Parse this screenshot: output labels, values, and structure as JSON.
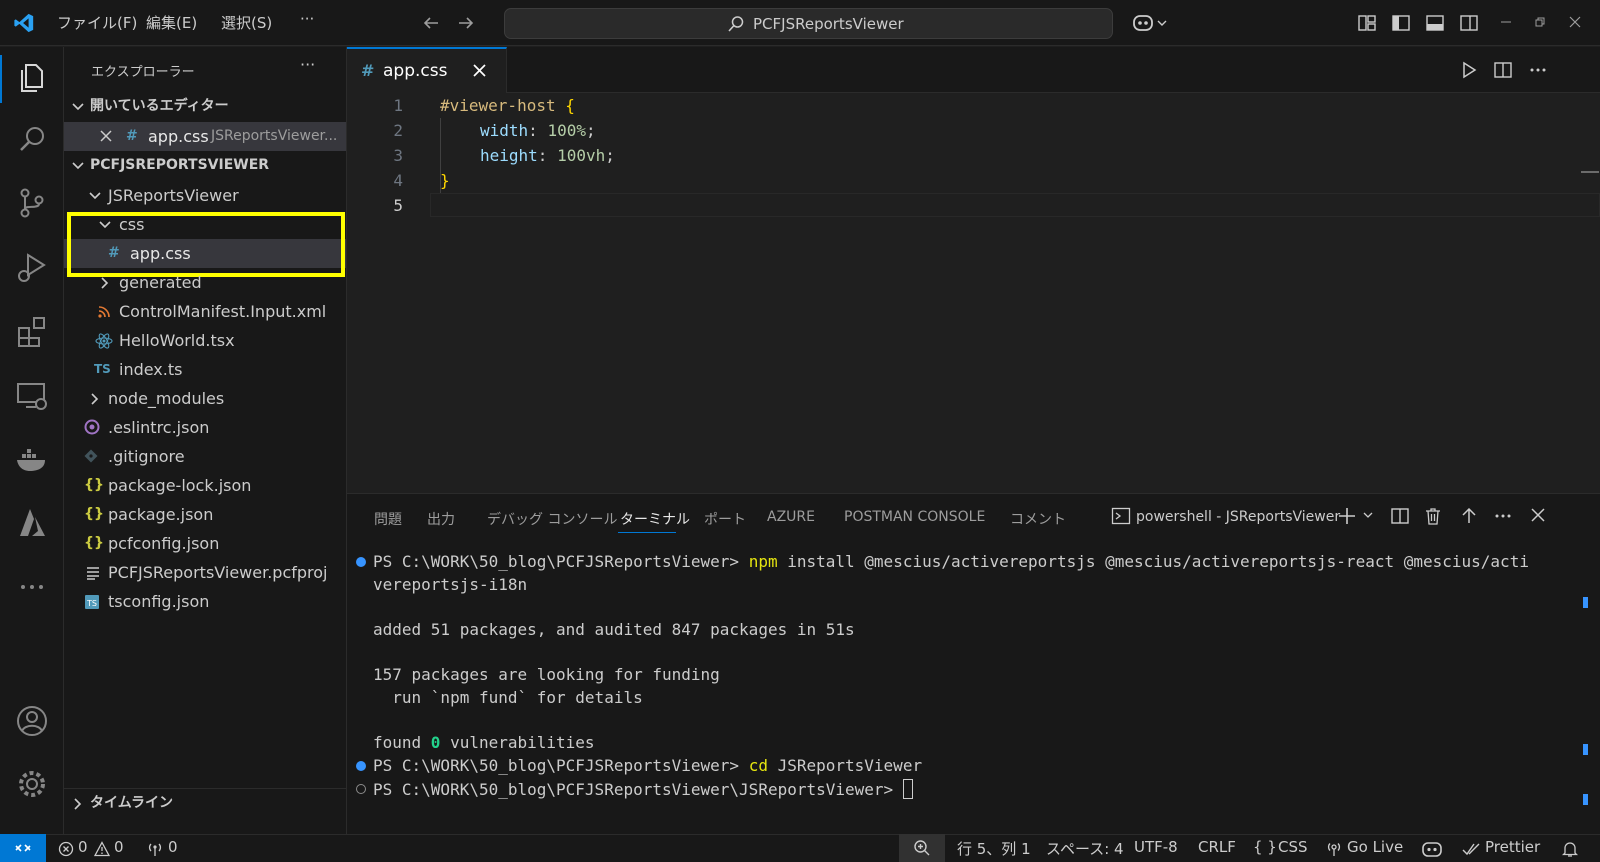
{
  "titlebar": {
    "menus": [
      "ファイル(F)",
      "編集(E)",
      "選択(S)"
    ],
    "more": "···",
    "search_text": "PCFJSReportsViewer"
  },
  "sidebar": {
    "title": "エクスプローラー",
    "more": "···",
    "open_editors_header": "開いているエディター",
    "open_editor_file": "app.css",
    "open_editor_path": "JSReportsViewer...",
    "project_header": "PCFJSREPORTSVIEWER",
    "tree": [
      {
        "label": "JSReportsViewer",
        "icon": "chevron-down"
      },
      {
        "label": "css",
        "icon": "chevron-down"
      },
      {
        "label": "app.css",
        "icon": "css-hash"
      },
      {
        "label": "generated",
        "icon": "chevron-right"
      },
      {
        "label": "ControlManifest.Input.xml",
        "icon": "rss"
      },
      {
        "label": "HelloWorld.tsx",
        "icon": "react"
      },
      {
        "label": "index.ts",
        "icon": "ts"
      },
      {
        "label": "node_modules",
        "icon": "chevron-right"
      },
      {
        "label": ".eslintrc.json",
        "icon": "eslint"
      },
      {
        "label": ".gitignore",
        "icon": "git"
      },
      {
        "label": "package-lock.json",
        "icon": "json"
      },
      {
        "label": "package.json",
        "icon": "json"
      },
      {
        "label": "pcfconfig.json",
        "icon": "json"
      },
      {
        "label": "PCFJSReportsViewer.pcfproj",
        "icon": "lines"
      },
      {
        "label": "tsconfig.json",
        "icon": "tsconfig"
      }
    ],
    "timeline_header": "タイムライン",
    "highlight_color": "#ffff00"
  },
  "editor": {
    "tab_label": "app.css",
    "tab_icon": "#",
    "line_numbers": [
      "1",
      "2",
      "3",
      "4",
      "5"
    ],
    "code": {
      "l1_selector": "#viewer-host",
      "l1_brace": " {",
      "l2_prop": "width",
      "l2_value": "100%",
      "l3_prop": "height",
      "l3_value": "100vh",
      "l4_brace": "}",
      "colon": ": ",
      "semi": ";"
    }
  },
  "panel": {
    "tabs": [
      "問題",
      "出力",
      "デバッグ コンソール",
      "ターミナル",
      "ポート",
      "AZURE",
      "POSTMAN CONSOLE",
      "コメント"
    ],
    "active_tab": "ターミナル",
    "terminal_name": "powershell - JSReportsViewer",
    "terminal": {
      "prompt1": "PS C:\\WORK\\50_blog\\PCFJSReportsViewer> ",
      "cmd1": "npm",
      "cmd1_rest": " install @mescius/activereportsjs @mescius/activereportsjs-react @mescius/acti",
      "cmd1_wrap": "vereportsjs-i18n",
      "out1": "added 51 packages, and audited 847 packages in 51s",
      "out2": "157 packages are looking for funding",
      "out3": "  run `npm fund` for details",
      "out4_a": "found ",
      "out4_zero": "0",
      "out4_b": " vulnerabilities",
      "prompt2": "PS C:\\WORK\\50_blog\\PCFJSReportsViewer> ",
      "cmd2": "cd",
      "cmd2_rest": " JSReportsViewer",
      "prompt3": "PS C:\\WORK\\50_blog\\PCFJSReportsViewer\\JSReportsViewer> "
    }
  },
  "statusbar": {
    "errors": "0",
    "warnings": "0",
    "ports": "0",
    "position": "行 5、列 1",
    "spaces": "スペース: 4",
    "encoding": "UTF-8",
    "eol": "CRLF",
    "language_braces": "{ }",
    "language": "CSS",
    "golive": "Go Live",
    "prettier": "Prettier"
  },
  "colors": {
    "accent": "#0078d4",
    "keyword_yellow": "#d7ba7d",
    "property_blue": "#9cdcfe",
    "value_green": "#b5cea8",
    "brace_yellow": "#ffd700",
    "command_yellow": "#e5e510"
  }
}
